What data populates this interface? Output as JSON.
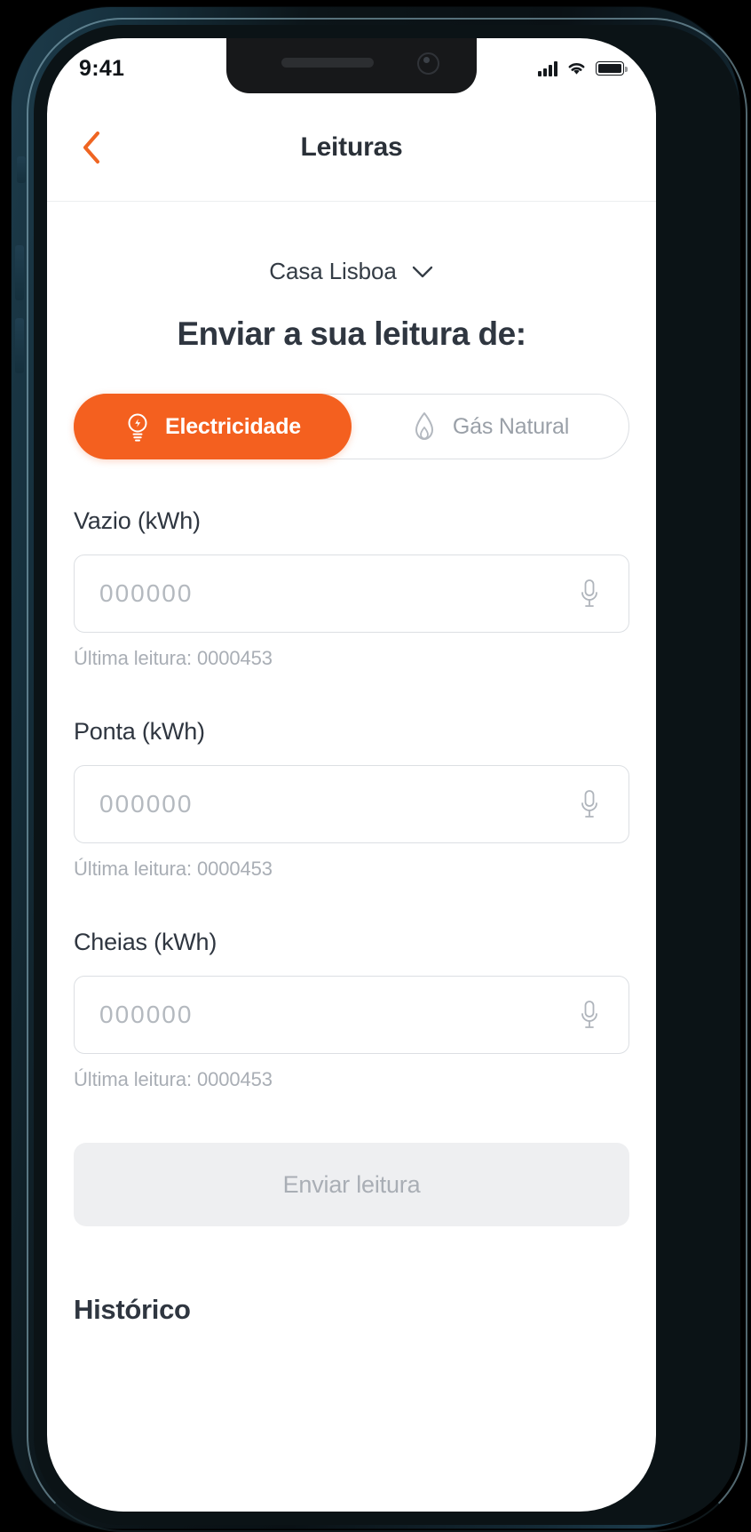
{
  "status_bar": {
    "time": "9:41",
    "signal_icon": "cellular-signal-icon",
    "wifi_icon": "wifi-icon",
    "battery_icon": "battery-icon"
  },
  "nav": {
    "title": "Leituras",
    "back_icon": "chevron-left-icon"
  },
  "house_selector": {
    "name": "Casa Lisboa",
    "chevron_icon": "chevron-down-icon"
  },
  "heading": "Enviar a sua leitura de:",
  "energy_toggle": {
    "options": [
      {
        "label": "Electricidade",
        "icon": "lightbulb-icon",
        "active": true
      },
      {
        "label": "Gás Natural",
        "icon": "flame-icon",
        "active": false
      }
    ]
  },
  "fields": [
    {
      "label": "Vazio (kWh)",
      "value": "",
      "placeholder": "000000",
      "hint": "Última leitura: 0000453",
      "mic_icon": "microphone-icon"
    },
    {
      "label": "Ponta (kWh)",
      "value": "",
      "placeholder": "000000",
      "hint": "Última leitura: 0000453",
      "mic_icon": "microphone-icon"
    },
    {
      "label": "Cheias (kWh)",
      "value": "",
      "placeholder": "000000",
      "hint": "Última leitura: 0000453",
      "mic_icon": "microphone-icon"
    }
  ],
  "submit_button": "Enviar leitura",
  "history_heading": "Histórico",
  "colors": {
    "accent": "#f4601f",
    "text_primary": "#2f3640",
    "text_muted": "#a9aeb5",
    "border": "#dcdfe3",
    "disabled_bg": "#eeeff1",
    "frame": "#16303d"
  }
}
